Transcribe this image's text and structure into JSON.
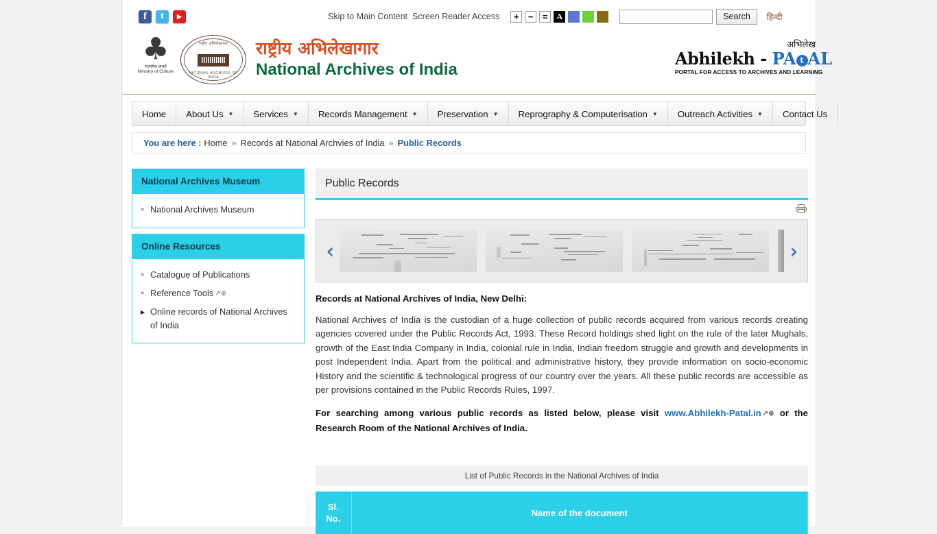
{
  "topbar": {
    "social": [
      {
        "name": "facebook-icon",
        "glyph": "f",
        "color": "#3b5a9b"
      },
      {
        "name": "twitter-icon",
        "glyph": "t",
        "color": "#45b4e8"
      },
      {
        "name": "youtube-icon",
        "glyph": "▶",
        "color": "#e02020"
      }
    ],
    "skip_link": "Skip to Main Content",
    "screen_reader": "Screen Reader Access",
    "font_increase": "+",
    "font_decrease": "−",
    "font_normal": "=",
    "contrast_a": "A",
    "swatch_blue": "#5b78cc",
    "swatch_green": "#6ed13c",
    "swatch_gold": "#8b6b11",
    "search_value": "",
    "search_placeholder": "",
    "search_button": "Search",
    "hindi_link": "हिन्दी"
  },
  "header": {
    "emblem_line1": "सत्यमेव जयते",
    "emblem_line2": "Ministry of Culture",
    "seal_top": "राष्ट्रीय अभिलेखागार",
    "seal_bottom": "NATIONAL ARCHIVES OF INDIA",
    "title_hindi": "राष्ट्रीय अभिलेखागार",
    "title_english": "National Archives of India",
    "patal_hindi": "अभिलेख",
    "patal_name_black": "Abhilekh",
    "patal_dash": " - ",
    "patal_pa": "PA",
    "patal_t": "t",
    "patal_al": "AL",
    "patal_tagline": "PORTAL FOR ACCESS TO ARCHIVES AND LEARNING"
  },
  "menu": [
    {
      "label": "Home",
      "caret": false
    },
    {
      "label": "About Us",
      "caret": true
    },
    {
      "label": "Services",
      "caret": true
    },
    {
      "label": "Records Management",
      "caret": true
    },
    {
      "label": "Preservation",
      "caret": true
    },
    {
      "label": "Reprography & Computerisation",
      "caret": true
    },
    {
      "label": "Outreach Activities",
      "caret": true
    },
    {
      "label": "Contact Us",
      "caret": false
    }
  ],
  "breadcrumb": {
    "lead": "You are here :",
    "home": "Home",
    "sep": "»",
    "parent": "Records at National Archvies of India",
    "current": "Public Records"
  },
  "sidebar": {
    "panels": [
      {
        "title": "National Archives Museum",
        "items": [
          {
            "label": "National Archives Museum",
            "bullet": "ring",
            "external": false
          }
        ]
      },
      {
        "title": "Online Resources",
        "items": [
          {
            "label": "Catalogue of Publications",
            "bullet": "ring",
            "external": false
          },
          {
            "label": "Reference Tools",
            "bullet": "ring",
            "external": true
          },
          {
            "label": "Online records of National Archives of India",
            "bullet": "tri",
            "external": false
          }
        ]
      }
    ]
  },
  "content": {
    "page_title": "Public Records",
    "print_icon": "printer-icon",
    "carousel": {
      "prev": "‹",
      "next": "›",
      "slide_count": 3
    },
    "lead_heading": "Records at National Archives of India, New Delhi:",
    "paragraph1": "National Archives of India is the custodian of a huge collection of public records acquired from  various  records creating agencies covered under the Public Records Act, 1993.  These Record holdings shed light on the rule of the later Mughals, growth of the East India Company in India, colonial rule in India, Indian freedom struggle and growth and developments in post Independent India. Apart from the political and administrative history, they provide information on socio-economic History and the scientific & technological progress of our country over the years.  All these public records are accessible as per provisions contained in the Public Records Rules, 1997.",
    "paragraph2_before": "For searching among various public records as listed below, please visit ",
    "paragraph2_link": "www.Abhilekh-Patal.in",
    "paragraph2_after": " or the Research Room of the National Archives of India.",
    "table_caption": "List of Public Records in the National Archives of India",
    "table_headers": {
      "sl_line1": "Sl.",
      "sl_line2": "No.",
      "name": "Name of the document"
    }
  },
  "colors": {
    "accent_cyan": "#2ccfe8",
    "link_blue": "#1f6fc4",
    "title_hindi_red": "#d94f20",
    "title_english_green": "#0a6b3d"
  }
}
